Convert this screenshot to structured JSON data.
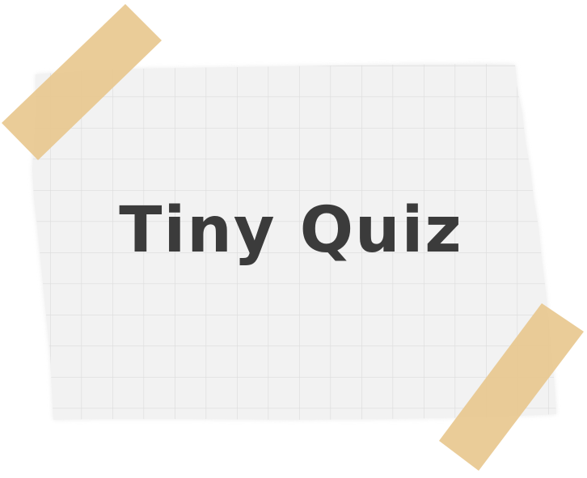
{
  "title": "Tiny Quiz",
  "colors": {
    "paper": "#f2f2f2",
    "grid": "#dcdcdc",
    "tape": "#e8c88f",
    "text": "#3b3b3b",
    "background": "#ffffff"
  },
  "decorations": {
    "tape_count": 2,
    "paper_style": "graph-paper with torn edges"
  }
}
